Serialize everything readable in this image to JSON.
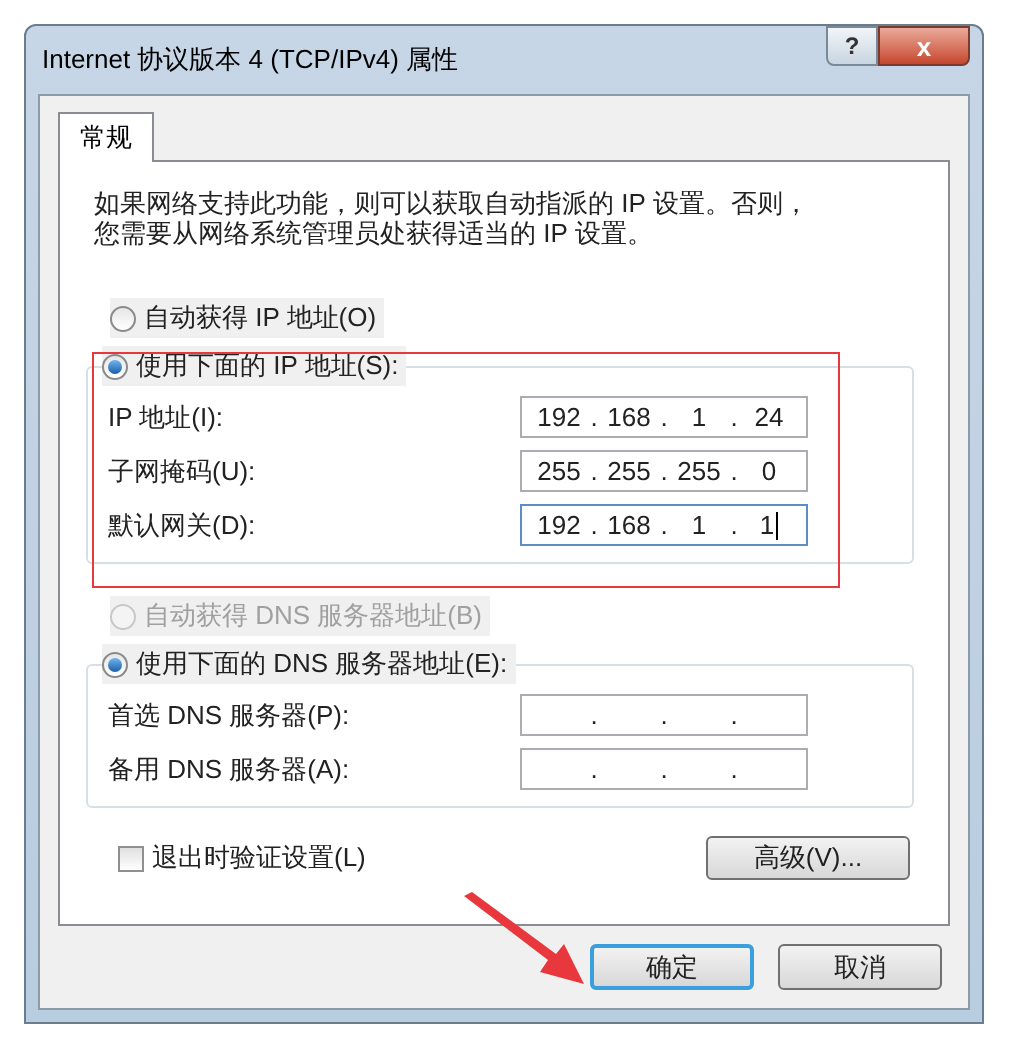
{
  "window": {
    "title": "Internet 协议版本 4 (TCP/IPv4) 属性",
    "help_button": "?",
    "close_button": "x"
  },
  "tabs": [
    {
      "label": "常规",
      "selected": true
    }
  ],
  "description": [
    "如果网络支持此功能，则可以获取自动指派的 IP 设置。否则，",
    "您需要从网络系统管理员处获得适当的 IP 设置。"
  ],
  "ip_section": {
    "options": [
      {
        "label": "自动获得 IP 地址(O)",
        "selected": false,
        "disabled": false
      },
      {
        "label": "使用下面的 IP 地址(S):",
        "selected": true,
        "disabled": false
      }
    ],
    "fields": [
      {
        "label": "IP 地址(I):",
        "octets": [
          "192",
          "168",
          "1",
          "24"
        ],
        "dots": [
          ".",
          ".",
          "."
        ],
        "focused": false
      },
      {
        "label": "子网掩码(U):",
        "octets": [
          "255",
          "255",
          "255",
          "0"
        ],
        "dots": [
          ".",
          ".",
          "."
        ],
        "focused": false
      },
      {
        "label": "默认网关(D):",
        "octets": [
          "192",
          "168",
          "1",
          "1"
        ],
        "dots": [
          ".",
          ".",
          "."
        ],
        "focused": true
      }
    ]
  },
  "dns_section": {
    "options": [
      {
        "label": "自动获得 DNS 服务器地址(B)",
        "selected": false,
        "disabled": true
      },
      {
        "label": "使用下面的 DNS 服务器地址(E):",
        "selected": true,
        "disabled": false
      }
    ],
    "fields": [
      {
        "label": "首选 DNS 服务器(P):",
        "dots": [
          ".",
          ".",
          "."
        ],
        "focused": false
      },
      {
        "label": "备用 DNS 服务器(A):",
        "dots": [
          ".",
          ".",
          "."
        ],
        "focused": false
      }
    ]
  },
  "validate_on_exit": {
    "label": "退出时验证设置(L)",
    "checked": false
  },
  "advanced_button": "高级(V)...",
  "buttons": [
    {
      "label": "确定",
      "default": true
    },
    {
      "label": "取消",
      "default": false
    }
  ]
}
